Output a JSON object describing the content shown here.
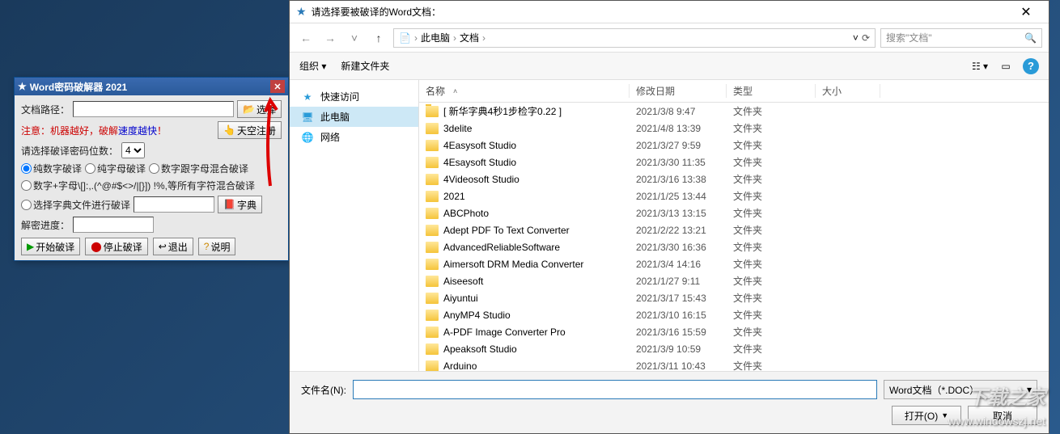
{
  "cracker": {
    "title": "Word密码破解器 2021",
    "path_label": "文档路径：",
    "choose_btn": "选择",
    "warn_prefix": "注意：机器越好，破解",
    "warn_link": "速度越快",
    "warn_suffix": "！",
    "sky_btn": "天空注册",
    "bits_label": "请选择破译密码位数：",
    "bits_value": "4",
    "r1": "纯数字破译",
    "r2": "纯字母破译",
    "r3": "数字跟字母混合破译",
    "r4": "数字+字母\\[]:,.(^@#$<>/|[}]) !%,等所有字符混合破译",
    "r5": "选择字典文件进行破译",
    "dict_btn": "字典",
    "progress_label": "解密进度：",
    "btn_start": "开始破译",
    "btn_stop": "停止破译",
    "btn_exit": "退出",
    "btn_help": "说明"
  },
  "dialog": {
    "title": "请选择要被破译的Word文档：",
    "breadcrumb": [
      "此电脑",
      "文档"
    ],
    "search_placeholder": "搜索\"文档\"",
    "toolbar_org": "组织",
    "toolbar_new": "新建文件夹",
    "sidebar": [
      {
        "icon": "star",
        "label": "快速访问"
      },
      {
        "icon": "pc",
        "label": "此电脑"
      },
      {
        "icon": "net",
        "label": "网络"
      }
    ],
    "cols": {
      "name": "名称",
      "date": "修改日期",
      "type": "类型",
      "size": "大小"
    },
    "rows": [
      {
        "name": "[ 新华字典4秒1步检字0.22 ]",
        "date": "2021/3/8 9:47",
        "type": "文件夹"
      },
      {
        "name": "3delite",
        "date": "2021/4/8 13:39",
        "type": "文件夹"
      },
      {
        "name": "4Easysoft Studio",
        "date": "2021/3/27 9:59",
        "type": "文件夹"
      },
      {
        "name": "4Esaysoft Studio",
        "date": "2021/3/30 11:35",
        "type": "文件夹"
      },
      {
        "name": "4Videosoft Studio",
        "date": "2021/3/16 13:38",
        "type": "文件夹"
      },
      {
        "name": "2021",
        "date": "2021/1/25 13:44",
        "type": "文件夹"
      },
      {
        "name": "ABCPhoto",
        "date": "2021/3/13 13:15",
        "type": "文件夹"
      },
      {
        "name": "Adept PDF To Text Converter",
        "date": "2021/2/22 13:21",
        "type": "文件夹"
      },
      {
        "name": "AdvancedReliableSoftware",
        "date": "2021/3/30 16:36",
        "type": "文件夹"
      },
      {
        "name": "Aimersoft DRM Media Converter",
        "date": "2021/3/4 14:16",
        "type": "文件夹"
      },
      {
        "name": "Aiseesoft",
        "date": "2021/1/27 9:11",
        "type": "文件夹"
      },
      {
        "name": "Aiyuntui",
        "date": "2021/3/17 15:43",
        "type": "文件夹"
      },
      {
        "name": "AnyMP4 Studio",
        "date": "2021/3/10 16:15",
        "type": "文件夹"
      },
      {
        "name": "A-PDF Image Converter Pro",
        "date": "2021/3/16 15:59",
        "type": "文件夹"
      },
      {
        "name": "Apeaksoft Studio",
        "date": "2021/3/9 10:59",
        "type": "文件夹"
      },
      {
        "name": "Arduino",
        "date": "2021/3/11 10:43",
        "type": "文件夹"
      }
    ],
    "filename_label": "文件名(N):",
    "filetype": "Word文档（*.DOC）",
    "open_btn": "打开(O)",
    "cancel_btn": "取消"
  },
  "watermark1": "下载之家",
  "watermark2": "www.windowszj.net"
}
